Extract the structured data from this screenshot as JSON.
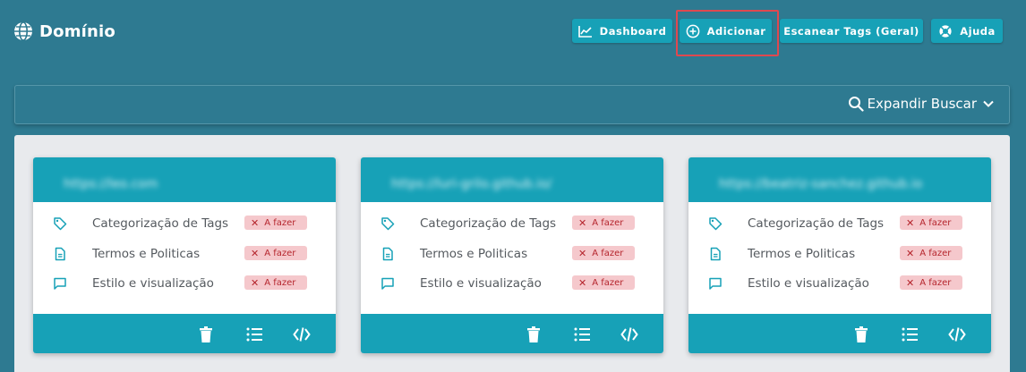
{
  "header": {
    "brand_title": "Domínio",
    "buttons": {
      "dashboard": "Dashboard",
      "add": "Adicionar",
      "scan": "Escanear Tags (Geral)",
      "help": "Ajuda"
    }
  },
  "search": {
    "toggle_label": "Expandir Buscar"
  },
  "colors": {
    "background": "#2e7a91",
    "accent": "#17a1b7",
    "panel": "#e8eaed",
    "badge_bg": "#f5c8cc",
    "badge_text": "#b5252d",
    "highlight": "#e0484f"
  },
  "cards": [
    {
      "url": "https://leo.com",
      "items": [
        {
          "icon": "tag-icon",
          "label": "Categorização de Tags",
          "status": "A fazer"
        },
        {
          "icon": "document-icon",
          "label": "Termos e Politicas",
          "status": "A fazer"
        },
        {
          "icon": "comment-icon",
          "label": "Estilo e visualização",
          "status": "A fazer"
        }
      ]
    },
    {
      "url": "https://luri-grilo.github.io/",
      "items": [
        {
          "icon": "tag-icon",
          "label": "Categorização de Tags",
          "status": "A fazer"
        },
        {
          "icon": "document-icon",
          "label": "Termos e Politicas",
          "status": "A fazer"
        },
        {
          "icon": "comment-icon",
          "label": "Estilo e visualização",
          "status": "A fazer"
        }
      ]
    },
    {
      "url": "https://beatriz-sanchez.github.io",
      "items": [
        {
          "icon": "tag-icon",
          "label": "Categorização de Tags",
          "status": "A fazer"
        },
        {
          "icon": "document-icon",
          "label": "Termos e Politicas",
          "status": "A fazer"
        },
        {
          "icon": "comment-icon",
          "label": "Estilo e visualização",
          "status": "A fazer"
        }
      ]
    }
  ]
}
